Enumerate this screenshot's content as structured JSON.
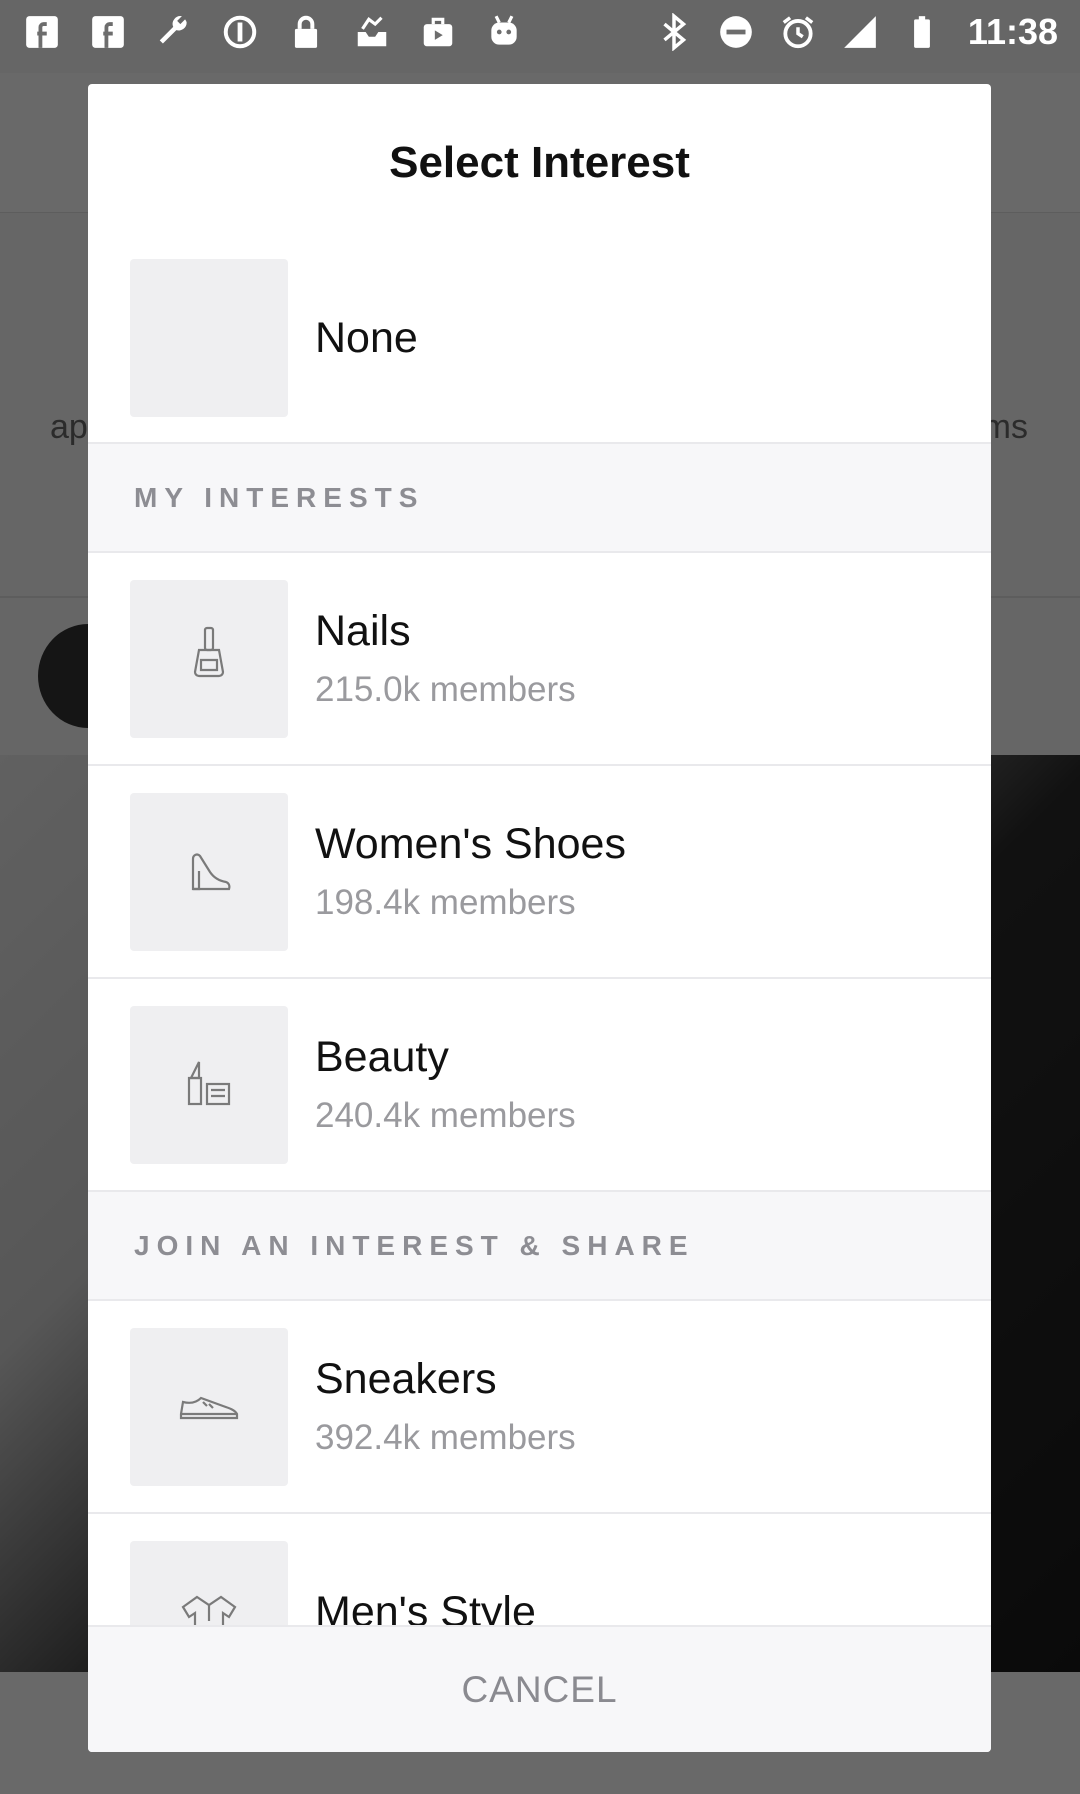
{
  "status_bar": {
    "time": "11:38",
    "left_icons": [
      "facebook-icon",
      "facebook-icon",
      "wrench-icon",
      "circle-info-icon",
      "lock-icon",
      "inbox-icon",
      "briefcase-icon",
      "android-icon"
    ],
    "right_icons": [
      "bluetooth-icon",
      "do-not-disturb-icon",
      "alarm-icon",
      "signal-icon",
      "battery-icon"
    ]
  },
  "background": {
    "text_left": "ap",
    "text_right": "ms"
  },
  "dialog": {
    "title": "Select Interest",
    "none_option": {
      "label": "None"
    },
    "sections": [
      {
        "header": "MY INTERESTS",
        "items": [
          {
            "name": "Nails",
            "members": "215.0k members",
            "icon": "nail-polish-icon"
          },
          {
            "name": "Women's Shoes",
            "members": "198.4k members",
            "icon": "high-heel-icon"
          },
          {
            "name": "Beauty",
            "members": "240.4k members",
            "icon": "lipstick-icon"
          }
        ]
      },
      {
        "header": "JOIN AN INTEREST & SHARE",
        "items": [
          {
            "name": "Sneakers",
            "members": "392.4k members",
            "icon": "sneaker-icon"
          },
          {
            "name": "Men's Style",
            "members": "",
            "icon": "shirt-icon"
          }
        ]
      }
    ],
    "cancel_label": "CANCEL"
  },
  "colors": {
    "scrim": "#000000",
    "dialog_bg": "#ffffff",
    "section_bg": "#f7f7f9",
    "thumb_bg": "#efeff1",
    "secondary_text": "#9a9a9e"
  }
}
